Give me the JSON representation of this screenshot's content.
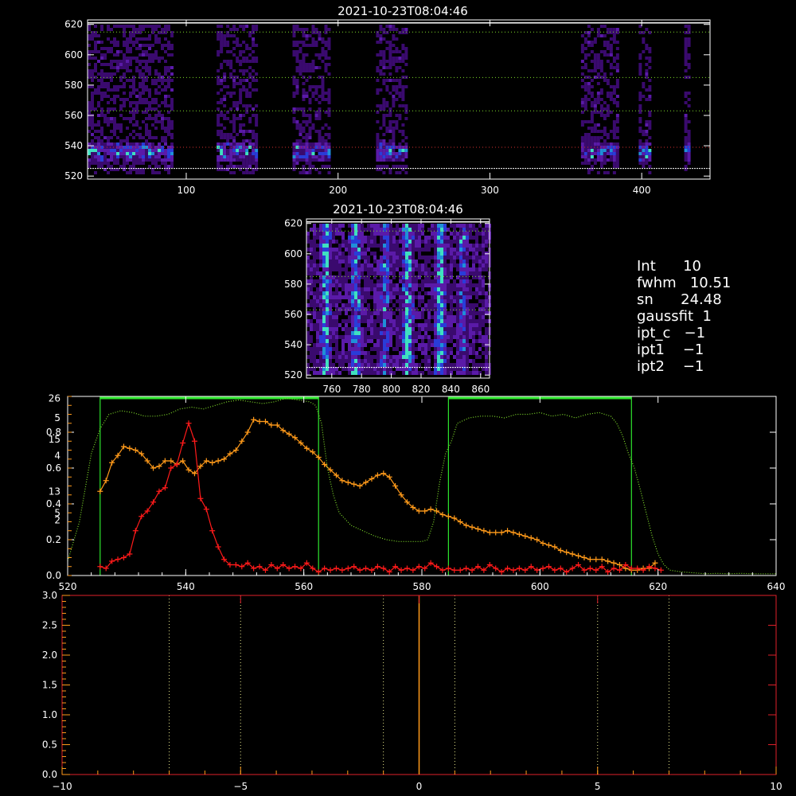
{
  "chart_data": [
    {
      "type": "heatmap",
      "title": "2021-10-23T08:04:46",
      "xlim": [
        35,
        445
      ],
      "ylim": [
        518,
        623
      ],
      "x_ticks": [
        "100",
        "200",
        "300",
        "400"
      ],
      "y_ticks": [
        "520",
        "540",
        "560",
        "580",
        "600",
        "620"
      ],
      "reference_lines": [
        525,
        539,
        563,
        585,
        615
      ],
      "data_blocks": [
        [
          35,
          90
        ],
        [
          120,
          147
        ],
        [
          170,
          195
        ],
        [
          225,
          245
        ],
        [
          360,
          385
        ],
        [
          398,
          405
        ],
        [
          428,
          432
        ]
      ]
    },
    {
      "type": "heatmap",
      "title": "2021-10-23T08:04:46",
      "xlim": [
        743,
        866
      ],
      "ylim": [
        518,
        623
      ],
      "x_ticks": [
        "760",
        "780",
        "800",
        "820",
        "840",
        "860"
      ],
      "y_ticks": [
        "520",
        "540",
        "560",
        "580",
        "600",
        "620"
      ],
      "reference_lines": [
        525,
        563,
        585,
        615
      ],
      "streaks": [
        [
          755,
          0.9
        ],
        [
          775,
          0.8
        ],
        [
          795,
          0.6
        ],
        [
          810,
          1.0
        ],
        [
          832,
          1.0
        ],
        [
          847,
          0.5
        ]
      ]
    },
    {
      "type": "line",
      "xlim": [
        520,
        640
      ],
      "ylim": [
        0,
        1
      ],
      "x_ticks": [
        "520",
        "540",
        "560",
        "580",
        "600",
        "620",
        "640"
      ],
      "y_ticks": [
        "0.0",
        "0.2",
        "0.4",
        "0.6",
        "0.8"
      ],
      "left_axis_overlay_labels": [
        "26",
        "5",
        "15",
        "4",
        "13",
        "5",
        "2"
      ],
      "series": [
        {
          "color": "#ff9a1a",
          "x": [
            525.5,
            526.5,
            527.5,
            528.5,
            529.5,
            530.5,
            531.5,
            532.5,
            533.5,
            534.5,
            535.5,
            536.5,
            537.5,
            538.5,
            539.5,
            540.5,
            541.5,
            542.5,
            543.5,
            544.5,
            545.5,
            546.5,
            547.5,
            548.5,
            549.5,
            550.5,
            551.5,
            552.5,
            553.5,
            554.5,
            555.5,
            556.5,
            557.5,
            558.5,
            559.5,
            560.5,
            561.5,
            562.5,
            563.5,
            564.5,
            565.5,
            566.5,
            567.5,
            568.5,
            569.5,
            570.5,
            571.5,
            572.5,
            573.5,
            574.5,
            575.5,
            576.5,
            577.5,
            578.5,
            579.5,
            580.5,
            581.5,
            582.5,
            583.5,
            584.5,
            585.5,
            586.5,
            587.5,
            588.5,
            589.5,
            590.5,
            591.5,
            592.5,
            593.5,
            594.5,
            595.5,
            596.5,
            597.5,
            598.5,
            599.5,
            600.5,
            601.5,
            602.5,
            603.5,
            604.5,
            605.5,
            606.5,
            607.5,
            608.5,
            609.5,
            610.5,
            611.5,
            612.5,
            613.5,
            614.5,
            615.5,
            616.5,
            617.5,
            618.5,
            619.5
          ],
          "y": [
            0.47,
            0.53,
            0.63,
            0.67,
            0.72,
            0.71,
            0.7,
            0.68,
            0.64,
            0.6,
            0.61,
            0.64,
            0.64,
            0.62,
            0.64,
            0.59,
            0.57,
            0.61,
            0.64,
            0.63,
            0.64,
            0.65,
            0.68,
            0.7,
            0.75,
            0.8,
            0.87,
            0.86,
            0.86,
            0.84,
            0.84,
            0.81,
            0.79,
            0.77,
            0.74,
            0.71,
            0.69,
            0.66,
            0.62,
            0.59,
            0.56,
            0.53,
            0.52,
            0.51,
            0.5,
            0.52,
            0.54,
            0.56,
            0.57,
            0.55,
            0.5,
            0.45,
            0.41,
            0.38,
            0.36,
            0.36,
            0.37,
            0.36,
            0.34,
            0.33,
            0.32,
            0.3,
            0.28,
            0.27,
            0.26,
            0.25,
            0.24,
            0.24,
            0.24,
            0.25,
            0.24,
            0.23,
            0.22,
            0.21,
            0.2,
            0.18,
            0.17,
            0.16,
            0.14,
            0.13,
            0.12,
            0.11,
            0.1,
            0.09,
            0.09,
            0.09,
            0.08,
            0.07,
            0.06,
            0.04,
            0.03,
            0.03,
            0.04,
            0.04,
            0.07
          ]
        },
        {
          "color": "#ff1a1a",
          "x": [
            525.5,
            526.5,
            527.5,
            528.5,
            529.5,
            530.5,
            531.5,
            532.5,
            533.5,
            534.5,
            535.5,
            536.5,
            537.5,
            538.5,
            539.5,
            540.5,
            541.5,
            542.5,
            543.5,
            544.5,
            545.5,
            546.5,
            547.5,
            548.5,
            549.5,
            550.5,
            551.5,
            552.5,
            553.5,
            554.5,
            555.5,
            556.5,
            557.5,
            558.5,
            559.5,
            560.5,
            561.5,
            562.5,
            563.5,
            564.5,
            565.5,
            566.5,
            567.5,
            568.5,
            569.5,
            570.5,
            571.5,
            572.5,
            573.5,
            574.5,
            575.5,
            576.5,
            577.5,
            578.5,
            579.5,
            580.5,
            581.5,
            582.5,
            583.5,
            584.5,
            585.5,
            586.5,
            587.5,
            588.5,
            589.5,
            590.5,
            591.5,
            592.5,
            593.5,
            594.5,
            595.5,
            596.5,
            597.5,
            598.5,
            599.5,
            600.5,
            601.5,
            602.5,
            603.5,
            604.5,
            605.5,
            606.5,
            607.5,
            608.5,
            609.5,
            610.5,
            611.5,
            612.5,
            613.5,
            614.5,
            615.5,
            616.5,
            617.5,
            618.5,
            619.5,
            620.5
          ],
          "y": [
            0.05,
            0.04,
            0.08,
            0.09,
            0.1,
            0.12,
            0.25,
            0.33,
            0.36,
            0.41,
            0.47,
            0.49,
            0.6,
            0.62,
            0.74,
            0.85,
            0.75,
            0.43,
            0.37,
            0.25,
            0.16,
            0.09,
            0.06,
            0.06,
            0.05,
            0.07,
            0.04,
            0.05,
            0.03,
            0.06,
            0.04,
            0.06,
            0.04,
            0.05,
            0.04,
            0.07,
            0.04,
            0.02,
            0.04,
            0.03,
            0.04,
            0.03,
            0.04,
            0.05,
            0.03,
            0.04,
            0.03,
            0.05,
            0.04,
            0.02,
            0.05,
            0.03,
            0.04,
            0.03,
            0.05,
            0.04,
            0.07,
            0.05,
            0.03,
            0.04,
            0.03,
            0.03,
            0.04,
            0.03,
            0.05,
            0.03,
            0.06,
            0.04,
            0.02,
            0.04,
            0.03,
            0.04,
            0.03,
            0.05,
            0.03,
            0.04,
            0.05,
            0.03,
            0.04,
            0.02,
            0.04,
            0.06,
            0.03,
            0.04,
            0.03,
            0.05,
            0.02,
            0.04,
            0.03,
            0.06,
            0.04,
            0.04,
            0.03,
            0.05,
            0.04,
            0.03
          ]
        },
        {
          "color": "#7fdc2a",
          "style": "dotted",
          "x": [
            520,
            522,
            524,
            525.5,
            527,
            529,
            531,
            533,
            535,
            537,
            539,
            541,
            543,
            545,
            547,
            549,
            551,
            553,
            555,
            557,
            559,
            561,
            562,
            563,
            564,
            565,
            566,
            568,
            570,
            572,
            574,
            576,
            578,
            580,
            581,
            582,
            583,
            584,
            585,
            586,
            588,
            590,
            592,
            594,
            596,
            598,
            600,
            602,
            604,
            606,
            608,
            610,
            612,
            613,
            614,
            615,
            616,
            617,
            618,
            619,
            620,
            621,
            622,
            624,
            626,
            628,
            630,
            632,
            634,
            636,
            638,
            640
          ],
          "y": [
            0.08,
            0.3,
            0.68,
            0.82,
            0.9,
            0.92,
            0.91,
            0.89,
            0.89,
            0.9,
            0.93,
            0.94,
            0.93,
            0.95,
            0.97,
            0.98,
            0.97,
            0.96,
            0.97,
            0.99,
            0.98,
            0.97,
            0.95,
            0.85,
            0.6,
            0.45,
            0.35,
            0.28,
            0.25,
            0.22,
            0.2,
            0.19,
            0.19,
            0.19,
            0.2,
            0.3,
            0.52,
            0.68,
            0.75,
            0.85,
            0.88,
            0.89,
            0.89,
            0.88,
            0.9,
            0.9,
            0.91,
            0.89,
            0.9,
            0.88,
            0.9,
            0.91,
            0.89,
            0.85,
            0.78,
            0.68,
            0.6,
            0.48,
            0.35,
            0.22,
            0.12,
            0.06,
            0.03,
            0.02,
            0.015,
            0.01,
            0.012,
            0.01,
            0.012,
            0.01,
            0.01,
            0.01
          ]
        }
      ],
      "green_regions": [
        [
          525.5,
          562.5
        ],
        [
          584.5,
          615.5
        ]
      ]
    },
    {
      "type": "line",
      "xlim": [
        -10,
        10
      ],
      "ylim": [
        0,
        3
      ],
      "x_ticks": [
        "−10",
        "−5",
        "0",
        "5",
        "10"
      ],
      "y_ticks": [
        "0.0",
        "0.5",
        "1.0",
        "1.5",
        "2.0",
        "2.5",
        "3.0"
      ],
      "vertical_markers": [
        -7,
        -5,
        -1,
        0,
        1,
        5,
        7
      ],
      "center_marker": 0
    }
  ],
  "info_panel": {
    "lines": [
      "Int      10",
      "fwhm   10.51",
      "sn      24.48",
      "gaussfit  1",
      "ipt_c   −1",
      "ipt1    −1",
      "ipt2    −1"
    ]
  },
  "colors": {
    "orange": "#ff9a1a",
    "red": "#ff1a1a",
    "green": "#2ee62e",
    "green_dotted": "#7fdc2a",
    "white": "#ffffff",
    "yellow_dotted": "#e6e68a"
  }
}
